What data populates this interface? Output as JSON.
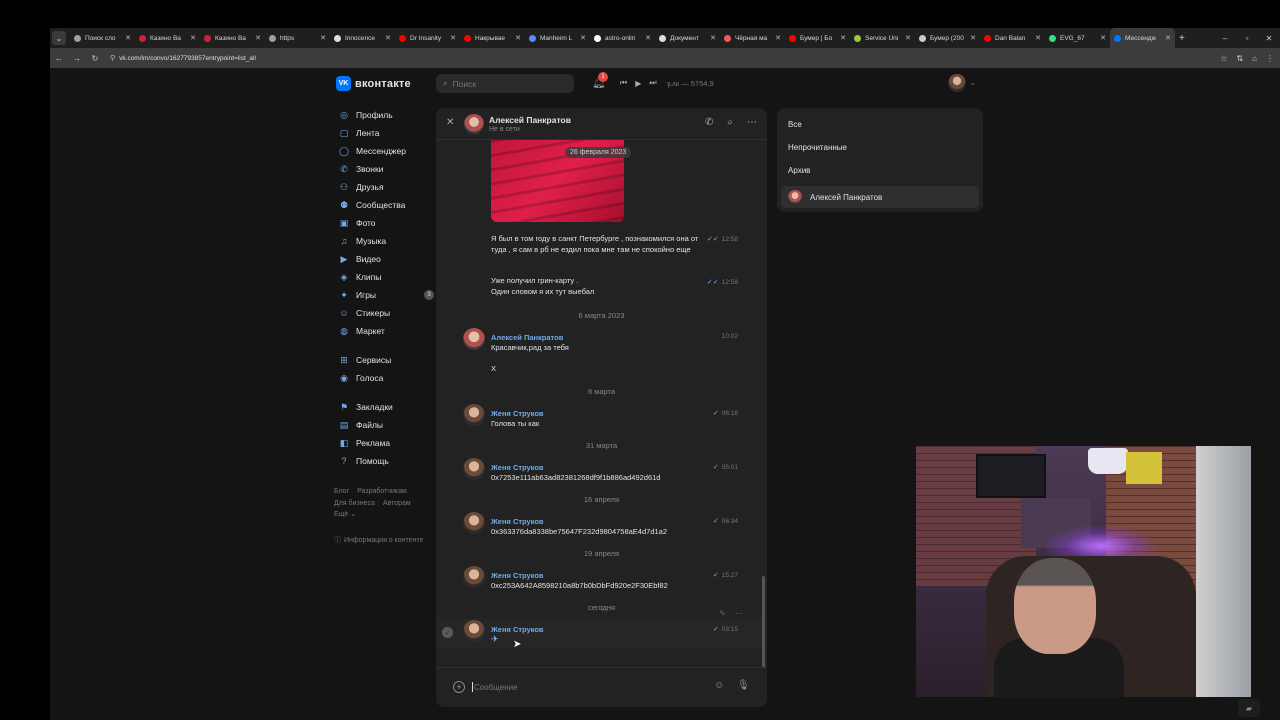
{
  "browser": {
    "tabs": [
      {
        "label": "Поиск сло",
        "color": "#9aa0a6"
      },
      {
        "label": "Казино Ва",
        "color": "#d21f3c"
      },
      {
        "label": "Казино Ва",
        "color": "#d21f3c"
      },
      {
        "label": "https",
        "color": "#9aa0a6"
      },
      {
        "label": "Innocence",
        "color": "#dddddd"
      },
      {
        "label": "Dr Insanity",
        "color": "#ff0000"
      },
      {
        "label": "Накрывае",
        "color": "#ff0000"
      },
      {
        "label": "Manheim L",
        "color": "#5b8def"
      },
      {
        "label": "astro-onlin",
        "color": "#ffffff"
      },
      {
        "label": "Документ",
        "color": "#dddddd"
      },
      {
        "label": "Чёрная ма",
        "color": "#ff5555"
      },
      {
        "label": "Бумер | Бо",
        "color": "#ff0000"
      },
      {
        "label": "Service Uni",
        "color": "#9acd32"
      },
      {
        "label": "Бумер (200",
        "color": "#cccccc"
      },
      {
        "label": "Dan Balan",
        "color": "#ff0000"
      },
      {
        "label": "EVG_67",
        "color": "#3ddc84"
      },
      {
        "label": "Мессендж",
        "color": "#0077ff",
        "active": true
      }
    ],
    "url": "vk.com/im/convo/1627793857entrypoint=list_all"
  },
  "header": {
    "logo_text": "вконтакте",
    "search_placeholder": "Поиск",
    "notification_count": "1",
    "track_text": "ɿʟʌк — 5†54,9"
  },
  "leftnav": {
    "items": [
      {
        "label": "Профиль",
        "icon": "profile-icon",
        "glyph": "◎"
      },
      {
        "label": "Лента",
        "icon": "feed-icon",
        "glyph": "▢"
      },
      {
        "label": "Мессенджер",
        "icon": "messenger-icon",
        "glyph": "◯"
      },
      {
        "label": "Звонки",
        "icon": "phone-icon",
        "glyph": "✆"
      },
      {
        "label": "Друзья",
        "icon": "friends-icon",
        "glyph": "⚇"
      },
      {
        "label": "Сообщества",
        "icon": "communities-icon",
        "glyph": "⚉"
      },
      {
        "label": "Фото",
        "icon": "photo-icon",
        "glyph": "▣"
      },
      {
        "label": "Музыка",
        "icon": "music-icon",
        "glyph": "♫"
      },
      {
        "label": "Видео",
        "icon": "video-icon",
        "glyph": "▶"
      },
      {
        "label": "Клипы",
        "icon": "clips-icon",
        "glyph": "◈"
      },
      {
        "label": "Игры",
        "icon": "games-icon",
        "glyph": "✦",
        "count": "3"
      },
      {
        "label": "Стикеры",
        "icon": "stickers-icon",
        "glyph": "☺"
      },
      {
        "label": "Маркет",
        "icon": "market-icon",
        "glyph": "◍"
      }
    ],
    "items2": [
      {
        "label": "Сервисы",
        "icon": "services-icon",
        "glyph": "⊞"
      },
      {
        "label": "Голоса",
        "icon": "votes-icon",
        "glyph": "◉"
      }
    ],
    "items3": [
      {
        "label": "Закладки",
        "icon": "bookmark-icon",
        "glyph": "⚑"
      },
      {
        "label": "Файлы",
        "icon": "files-icon",
        "glyph": "▤"
      },
      {
        "label": "Реклама",
        "icon": "ads-icon",
        "glyph": "◧"
      },
      {
        "label": "Помощь",
        "icon": "help-icon",
        "glyph": "?"
      }
    ],
    "footer": {
      "blog": "Блог",
      "developers": "Разработчикам",
      "business": "Для бизнеса",
      "authors": "Авторам",
      "more": "Ещё ⌄",
      "info": "Информация о контенте"
    }
  },
  "chat": {
    "name": "Алексей Панкратов",
    "status": "Не в сети",
    "photo_date": "26 февраля 2023",
    "messages": {
      "m1_text": "Я был в том году в санкт Петербурге , познакомился она от туда , я сам в рб не ездил пока мне там не спокойно еще",
      "m1_time": "12:58",
      "m2_line1": "Уже получил грин-карту .",
      "m2_line2": "Один словом я их тут выебал",
      "m2_time": "12:58",
      "d1": "6 марта 2023",
      "m3_author": "Алексей Панкратов",
      "m3_line1": "Красавчик,рад за тебя",
      "m3_line2": "Х",
      "m3_time": "10:02",
      "d2": "6 марта",
      "m4_author": "Женя Струков",
      "m4_text": "Голова ты как",
      "m4_time": "06:18",
      "d3": "31 марта",
      "m5_author": "Женя Струков",
      "m5_text": "0x7253e111ab63ad82381268df9f1b886ad492d61d",
      "m5_time": "05:01",
      "d4": "16 апреля",
      "m6_author": "Женя Струков",
      "m6_text": "0x363376da8338be75647F232d9804758aE4d7d1a2",
      "m6_time": "06:34",
      "d5": "19 апреля",
      "m7_author": "Женя Струков",
      "m7_text": "0xc253A642A8598210a8b7b0bDbFd920e2F30Ebf82",
      "m7_time": "15:27",
      "d6": "сегодня",
      "m8_author": "Женя Струков",
      "m8_time": "03:15"
    },
    "composer_placeholder": "Сообщение"
  },
  "filters": {
    "all": "Все",
    "unread": "Непрочитанные",
    "archive": "Архив",
    "active_name": "Алексей Панкратов"
  }
}
